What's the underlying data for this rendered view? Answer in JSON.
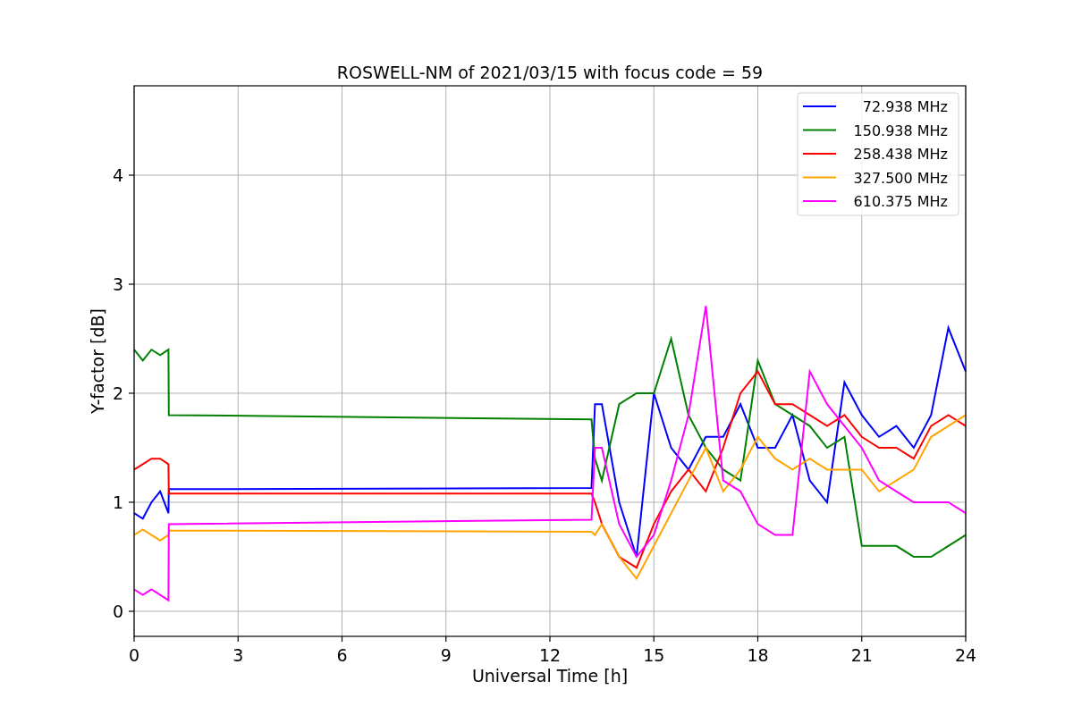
{
  "chart": {
    "chart_data": {
      "type": "line",
      "title": "ROSWELL-NM of 2021/03/15 with focus code = 59",
      "xlabel": "Universal Time [h]",
      "ylabel": "Y-factor [dB]",
      "x": [
        0,
        0.25,
        0.5,
        0.75,
        0.99,
        1,
        13.2,
        13.3,
        13.5,
        14,
        14.5,
        15,
        15.5,
        16,
        16.5,
        17,
        17.5,
        18,
        18.5,
        19,
        19.5,
        20,
        20.5,
        21,
        21.5,
        22,
        22.5,
        23,
        23.5,
        24
      ],
      "series": [
        {
          "name": " 72.938 MHz",
          "color": "#0000ff",
          "values": [
            0.9,
            0.85,
            1.0,
            1.1,
            0.9,
            1.12,
            1.13,
            1.9,
            1.9,
            1.0,
            0.5,
            2.0,
            1.5,
            1.3,
            1.6,
            1.6,
            1.9,
            1.5,
            1.5,
            1.8,
            1.2,
            1.0,
            2.1,
            1.8,
            1.6,
            1.7,
            1.5,
            1.8,
            2.6,
            2.2
          ]
        },
        {
          "name": "150.938 MHz",
          "color": "#008000",
          "values": [
            2.4,
            2.3,
            2.4,
            2.35,
            2.4,
            1.8,
            1.76,
            1.4,
            1.2,
            1.9,
            2.0,
            2.0,
            2.5,
            1.8,
            1.5,
            1.3,
            1.2,
            2.3,
            1.9,
            1.8,
            1.7,
            1.5,
            1.6,
            0.6,
            0.6,
            0.6,
            0.5,
            0.5,
            0.6,
            0.7
          ]
        },
        {
          "name": "258.438 MHz",
          "color": "#ff0000",
          "values": [
            1.3,
            1.35,
            1.4,
            1.4,
            1.35,
            1.08,
            1.08,
            1.0,
            0.8,
            0.5,
            0.4,
            0.8,
            1.1,
            1.3,
            1.1,
            1.5,
            2.0,
            2.2,
            1.9,
            1.9,
            1.8,
            1.7,
            1.8,
            1.6,
            1.5,
            1.5,
            1.4,
            1.7,
            1.8,
            1.7
          ]
        },
        {
          "name": "327.500 MHz",
          "color": "#ffa500",
          "values": [
            0.7,
            0.75,
            0.7,
            0.65,
            0.7,
            0.74,
            0.73,
            0.7,
            0.8,
            0.5,
            0.3,
            0.6,
            0.9,
            1.2,
            1.5,
            1.1,
            1.3,
            1.6,
            1.4,
            1.3,
            1.4,
            1.3,
            1.3,
            1.3,
            1.1,
            1.2,
            1.3,
            1.6,
            1.7,
            1.8
          ]
        },
        {
          "name": "610.375 MHz",
          "color": "#ff00ff",
          "values": [
            0.2,
            0.15,
            0.2,
            0.15,
            0.1,
            0.8,
            0.84,
            1.5,
            1.5,
            0.8,
            0.5,
            0.7,
            1.2,
            1.8,
            2.8,
            1.2,
            1.1,
            0.8,
            0.7,
            0.7,
            2.2,
            1.9,
            1.7,
            1.5,
            1.2,
            1.1,
            1.0,
            1.0,
            1.0,
            0.9
          ]
        }
      ],
      "xlim": [
        0,
        24
      ],
      "ylim": [
        -0.23,
        4.82
      ],
      "xticks": [
        0,
        3,
        6,
        9,
        12,
        15,
        18,
        21,
        24
      ],
      "yticks": [
        0,
        1,
        2,
        3,
        4
      ],
      "grid": true,
      "legend": true
    }
  }
}
